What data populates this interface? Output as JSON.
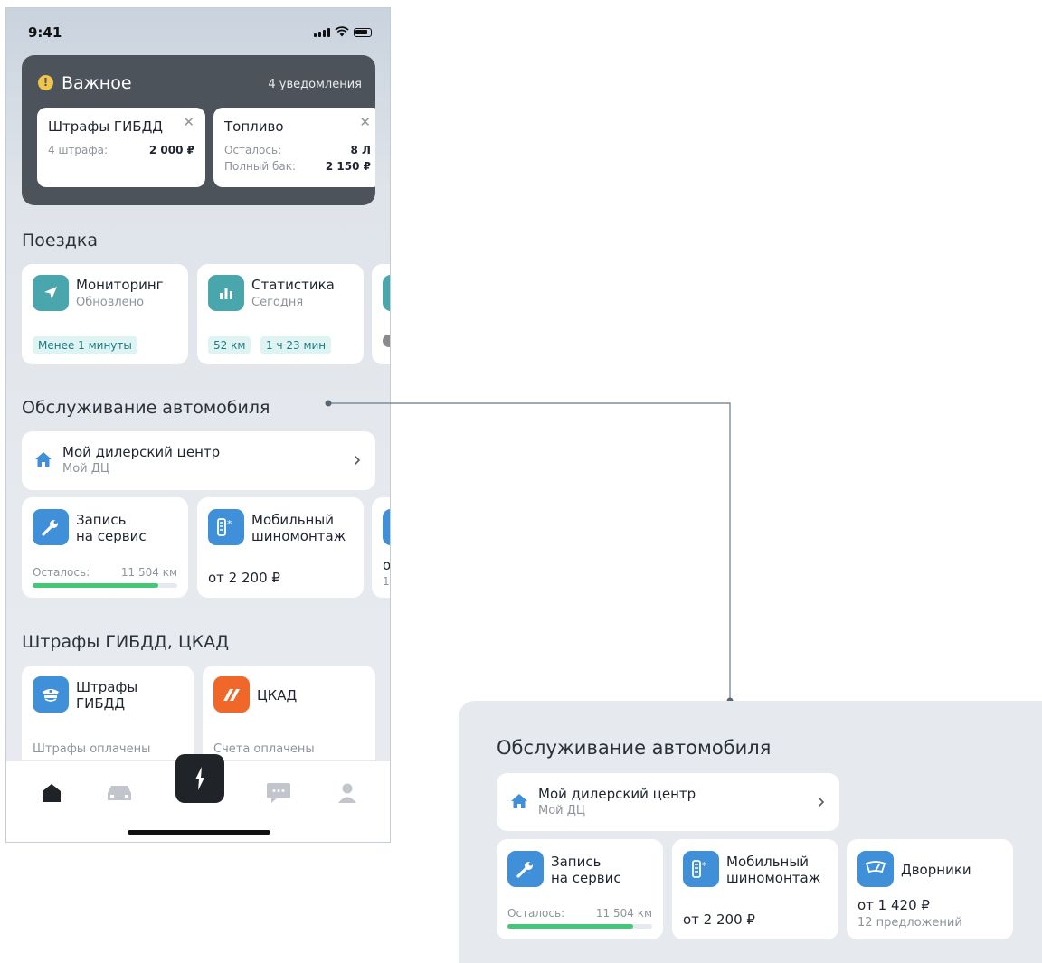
{
  "status": {
    "time": "9:41"
  },
  "important": {
    "title": "Важное",
    "count": "4 уведомления",
    "cards": [
      {
        "title": "Штрафы ГИБДД",
        "rows": [
          {
            "label": "4 штрафа:",
            "value": "2 000 ₽"
          }
        ]
      },
      {
        "title": "Топливо",
        "rows": [
          {
            "label": "Осталось:",
            "value": "8 Л"
          },
          {
            "label": "Полный бак:",
            "value": "2 150 ₽"
          }
        ]
      }
    ]
  },
  "trip": {
    "title": "Поездка",
    "cards": [
      {
        "title": "Мониторинг",
        "subtitle": "Обновлено",
        "chips": [
          "Менее 1 минуты"
        ]
      },
      {
        "title": "Статистика",
        "subtitle": "Сегодня",
        "chips": [
          "52 км",
          "1 ч 23 мин"
        ]
      }
    ]
  },
  "service": {
    "title": "Обслуживание автомобиля",
    "dealer": {
      "title": "Мой дилерский центр",
      "subtitle": "Мой ДЦ"
    },
    "booking": {
      "title_line1": "Запись",
      "title_line2": "на сервис",
      "remaining_label": "Осталось:",
      "remaining_value": "11 504 км",
      "progress": 0.87
    },
    "tire": {
      "title_line1": "Мобильный",
      "title_line2": "шиномонтаж",
      "price": "от 2 200 ₽"
    },
    "wipers": {
      "title": "Дворники",
      "price": "от 1 420 ₽",
      "offers": "12 предложений"
    },
    "partial_price": "о",
    "partial_sub": "12"
  },
  "fines": {
    "title": "Штрафы ГИБДД, ЦКАД",
    "gibdd": {
      "title_line1": "Штрафы",
      "title_line2": "ГИБДД",
      "status": "Штрафы оплачены"
    },
    "ckad": {
      "title": "ЦКАД",
      "status": "Счета оплачены"
    }
  },
  "colors": {
    "accent_teal": "#4aa6ad",
    "accent_blue": "#3f8fd9",
    "progress": "#45c77a",
    "ckad": "#f0672a",
    "warn": "#f1c54a"
  }
}
